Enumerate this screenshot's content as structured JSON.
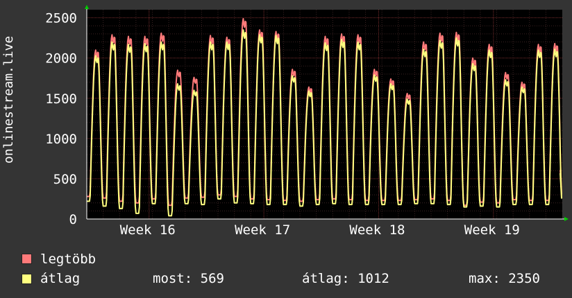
{
  "chart_data": {
    "type": "line",
    "ylabel": "onlinestream.live",
    "ylim": [
      0,
      2600
    ],
    "yticks": [
      0,
      500,
      1000,
      1500,
      2000,
      2500
    ],
    "xtick_labels": [
      "Week 16",
      "Week 17",
      "Week 18",
      "Week 19"
    ],
    "grid": true,
    "series": [
      {
        "name": "legtöbb",
        "color": "#ff7a7a",
        "days": [
          {
            "lo": 280,
            "hi": 2100
          },
          {
            "lo": 260,
            "hi": 2290
          },
          {
            "lo": 220,
            "hi": 2270
          },
          {
            "lo": 200,
            "hi": 2270
          },
          {
            "lo": 250,
            "hi": 2310
          },
          {
            "lo": 170,
            "hi": 1850
          },
          {
            "lo": 260,
            "hi": 1760
          },
          {
            "lo": 270,
            "hi": 2280
          },
          {
            "lo": 300,
            "hi": 2260
          },
          {
            "lo": 280,
            "hi": 2490
          },
          {
            "lo": 250,
            "hi": 2350
          },
          {
            "lo": 240,
            "hi": 2330
          },
          {
            "lo": 230,
            "hi": 1860
          },
          {
            "lo": 220,
            "hi": 1640
          },
          {
            "lo": 240,
            "hi": 2270
          },
          {
            "lo": 250,
            "hi": 2300
          },
          {
            "lo": 240,
            "hi": 2290
          },
          {
            "lo": 230,
            "hi": 1860
          },
          {
            "lo": 230,
            "hi": 1740
          },
          {
            "lo": 230,
            "hi": 1560
          },
          {
            "lo": 240,
            "hi": 2200
          },
          {
            "lo": 250,
            "hi": 2310
          },
          {
            "lo": 230,
            "hi": 2320
          },
          {
            "lo": 170,
            "hi": 2000
          },
          {
            "lo": 210,
            "hi": 2170
          },
          {
            "lo": 200,
            "hi": 1820
          },
          {
            "lo": 240,
            "hi": 1700
          },
          {
            "lo": 230,
            "hi": 2170
          },
          {
            "lo": 230,
            "hi": 2180
          }
        ]
      },
      {
        "name": "átlag",
        "color": "#ffff80",
        "days": [
          {
            "lo": 220,
            "hi": 2030
          },
          {
            "lo": 160,
            "hi": 2200
          },
          {
            "lo": 130,
            "hi": 2170
          },
          {
            "lo": 70,
            "hi": 2180
          },
          {
            "lo": 190,
            "hi": 2200
          },
          {
            "lo": 40,
            "hi": 1680
          },
          {
            "lo": 190,
            "hi": 1600
          },
          {
            "lo": 180,
            "hi": 2200
          },
          {
            "lo": 250,
            "hi": 2200
          },
          {
            "lo": 200,
            "hi": 2350
          },
          {
            "lo": 190,
            "hi": 2290
          },
          {
            "lo": 180,
            "hi": 2280
          },
          {
            "lo": 180,
            "hi": 1780
          },
          {
            "lo": 160,
            "hi": 1590
          },
          {
            "lo": 180,
            "hi": 2190
          },
          {
            "lo": 190,
            "hi": 2230
          },
          {
            "lo": 180,
            "hi": 2200
          },
          {
            "lo": 180,
            "hi": 1790
          },
          {
            "lo": 180,
            "hi": 1680
          },
          {
            "lo": 180,
            "hi": 1490
          },
          {
            "lo": 190,
            "hi": 2110
          },
          {
            "lo": 190,
            "hi": 2220
          },
          {
            "lo": 180,
            "hi": 2250
          },
          {
            "lo": 150,
            "hi": 1930
          },
          {
            "lo": 160,
            "hi": 2100
          },
          {
            "lo": 150,
            "hi": 1730
          },
          {
            "lo": 180,
            "hi": 1640
          },
          {
            "lo": 180,
            "hi": 2100
          },
          {
            "lo": 180,
            "hi": 2110
          }
        ]
      }
    ],
    "end_value": 569
  },
  "legend": {
    "max_label": "legtöbb",
    "avg_label": "átlag",
    "most_text": "most: 569",
    "atlag_text": "átlag: 1012",
    "max_text": "max: 2350"
  }
}
